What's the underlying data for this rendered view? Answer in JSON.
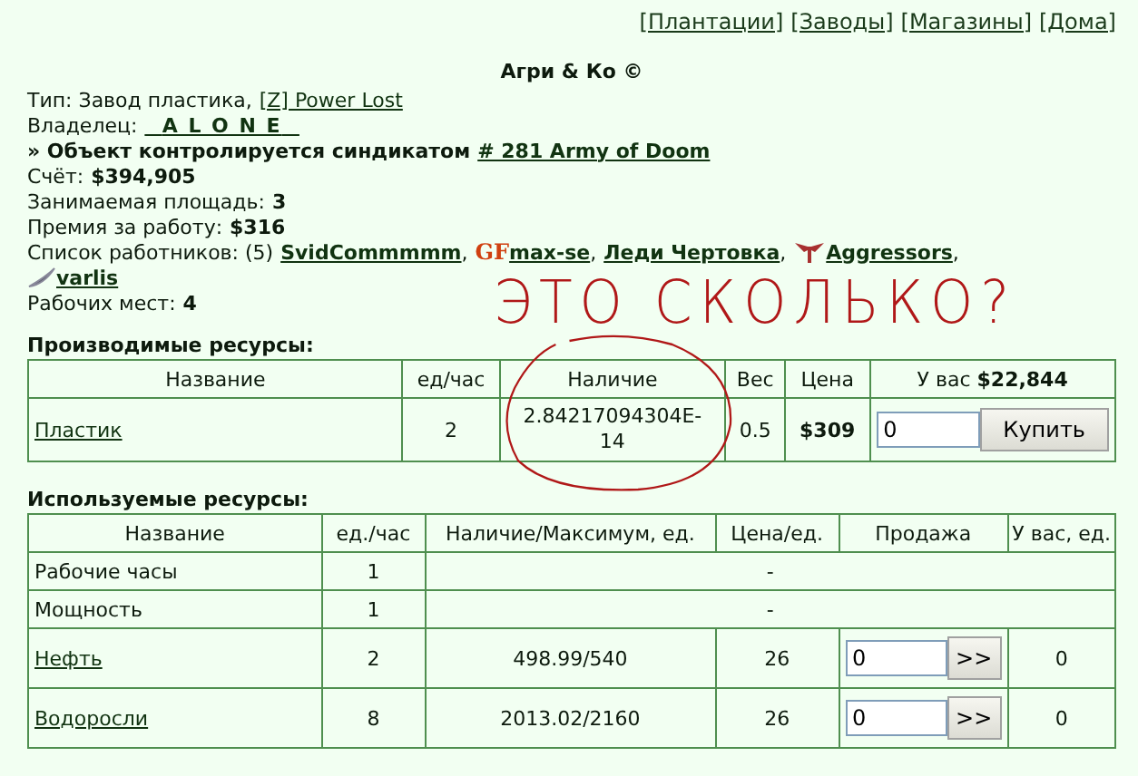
{
  "nav": [
    "[Плантации]",
    "[Заводы]",
    "[Магазины]",
    "[Дома]"
  ],
  "title": "Агри & Ко ©",
  "info": {
    "type_label": "Тип: Завод пластика,",
    "type_link": "[Z] Power Lost",
    "owner_label": "Владелец:",
    "owner": "A L O N E",
    "syndicate_text": "» Объект контролируется синдикатом",
    "syndicate_link": "# 281 Army of Doom",
    "account_label": "Счёт:",
    "account": "$394,905",
    "area_label": "Занимаемая площадь:",
    "area": "3",
    "bonus_label": "Премия за работу:",
    "bonus": "$316",
    "workers_label": "Список работников: (5)",
    "workers": [
      {
        "name": "SvidCommmmm",
        "kind": "plain",
        "separator": ","
      },
      {
        "name": "max-se",
        "kind": "text_badge",
        "badge": "GF",
        "separator": ","
      },
      {
        "name": "Леди Чертовка",
        "kind": "plain",
        "separator": ","
      },
      {
        "name": "Aggressors",
        "kind": "wings",
        "separator": ","
      },
      {
        "name": "varlis",
        "kind": "blade"
      }
    ],
    "places_label": "Рабочих мест:",
    "places": "4"
  },
  "annotation": {
    "text": "ЭТО СКОЛЬКО?"
  },
  "produced": {
    "heading": "Производимые ресурсы:",
    "columns": [
      "Название",
      "ед/час",
      "Наличие",
      "Вес",
      "Цена",
      "У вас **$22,844**"
    ],
    "rows": [
      {
        "name": "Пластик",
        "rate": "2",
        "stock": "2.84217094304E-14",
        "weight": "0.5",
        "price": "$309",
        "amount": "0",
        "button": "Купить"
      }
    ]
  },
  "used": {
    "heading": "Используемые ресурсы:",
    "columns": [
      "Название",
      "ед./час",
      "Наличие/Максимум, ед.",
      "Цена/ед.",
      "Продажа",
      "У вас, ед."
    ],
    "rows": [
      {
        "kind": "span",
        "name": "Рабочие часы",
        "link": false,
        "rate": "1",
        "value": "-"
      },
      {
        "kind": "span",
        "name": "Мощность",
        "link": false,
        "rate": "1",
        "value": "-"
      },
      {
        "kind": "trade",
        "name": "Нефть",
        "link": true,
        "rate": "2",
        "stock": "498.99/540",
        "price": "26",
        "amount": "0",
        "button": ">>",
        "owned": "0"
      },
      {
        "kind": "trade",
        "name": "Водоросли",
        "link": true,
        "rate": "8",
        "stock": "2013.02/2160",
        "price": "26",
        "amount": "0",
        "button": ">>",
        "owned": "0"
      }
    ]
  }
}
